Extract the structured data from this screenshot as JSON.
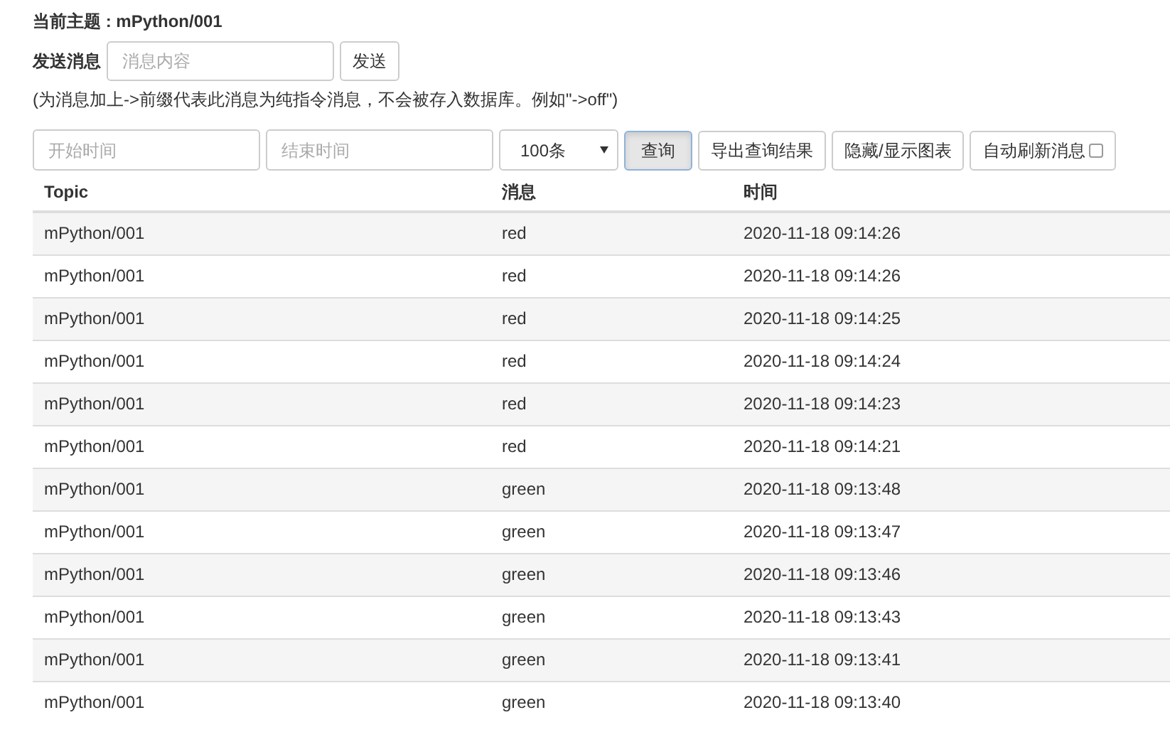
{
  "topic_heading": "当前主题 : mPython/001",
  "send": {
    "label": "发送消息",
    "placeholder": "消息内容",
    "button": "发送"
  },
  "hint": "(为消息加上->前缀代表此消息为纯指令消息，不会被存入数据库。例如\"->off\")",
  "filters": {
    "start_placeholder": "开始时间",
    "end_placeholder": "结束时间",
    "limit": "100条"
  },
  "buttons": [
    {
      "label": "查询",
      "pressed": true
    },
    {
      "label": "导出查询结果",
      "pressed": false
    },
    {
      "label": "隐藏/显示图表",
      "pressed": false
    }
  ],
  "auto_refresh": {
    "label": "自动刷新消息",
    "checked": false
  },
  "table": {
    "columns": [
      "Topic",
      "消息",
      "时间"
    ],
    "rows": [
      [
        "mPython/001",
        "red",
        "2020-11-18 09:14:26"
      ],
      [
        "mPython/001",
        "red",
        "2020-11-18 09:14:26"
      ],
      [
        "mPython/001",
        "red",
        "2020-11-18 09:14:25"
      ],
      [
        "mPython/001",
        "red",
        "2020-11-18 09:14:24"
      ],
      [
        "mPython/001",
        "red",
        "2020-11-18 09:14:23"
      ],
      [
        "mPython/001",
        "red",
        "2020-11-18 09:14:21"
      ],
      [
        "mPython/001",
        "green",
        "2020-11-18 09:13:48"
      ],
      [
        "mPython/001",
        "green",
        "2020-11-18 09:13:47"
      ],
      [
        "mPython/001",
        "green",
        "2020-11-18 09:13:46"
      ],
      [
        "mPython/001",
        "green",
        "2020-11-18 09:13:43"
      ],
      [
        "mPython/001",
        "green",
        "2020-11-18 09:13:41"
      ],
      [
        "mPython/001",
        "green",
        "2020-11-18 09:13:40"
      ]
    ]
  }
}
